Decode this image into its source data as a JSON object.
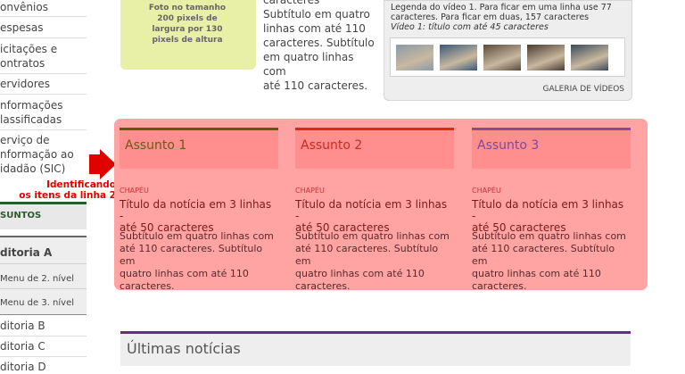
{
  "sidebar": {
    "items": [
      {
        "lines": [
          "onvênios"
        ]
      },
      {
        "lines": [
          "espesas"
        ]
      },
      {
        "lines": [
          "icitações e",
          "ontratos"
        ]
      },
      {
        "lines": [
          "ervidores"
        ]
      },
      {
        "lines": [
          "nformações",
          "lassificadas"
        ]
      },
      {
        "lines": [
          "erviço de",
          "nformação ao",
          "idadão (SIC)"
        ]
      }
    ],
    "assuntos": "SUNTOS",
    "editoria_a": "ditoria A",
    "menu_2": "Menu de 2. nível",
    "menu_3": "Menu de 3. nível",
    "editoria_b": "ditoria B",
    "editoria_c": "ditoria C",
    "editoria_d": "ditoria D"
  },
  "photo_placeholder": {
    "lines": [
      "Foto no tamanho",
      "200 pixels de",
      "largura por 130",
      "pixels de altura"
    ]
  },
  "top_subtitle": {
    "lines": [
      "caracteres",
      "Subtítulo em quatro",
      "linhas com até 110",
      "caracteres. Subtítulo",
      "em quatro linhas com",
      "até 110 caracteres."
    ]
  },
  "video": {
    "legend_lines": [
      "Legenda do vídeo 1. Para ficar em uma linha use 77",
      "caracteres. Para ficar em duas, 157 caracteres"
    ],
    "caption": "Vídeo 1: título com até 45 caracteres",
    "thumb_colors": [
      "#8a9aa8",
      "#3a5878",
      "#5a4a3a",
      "#4a3a30",
      "#3a4a5a"
    ],
    "gallery_label": "GALERIA DE VÍDEOS"
  },
  "annotation": {
    "lines": [
      "Identificando",
      "os itens da linha 2"
    ]
  },
  "colors": {
    "accent_red": "#e00000",
    "panel_pink": "#ffa3a3"
  },
  "columns": [
    {
      "title": "Assunto 1",
      "title_color": "#6a5a14",
      "bar_color": "#5a5a10",
      "chapeu": "CHAPÉU",
      "headline_lines": [
        "Título da notícia em 3 linhas -",
        "até 50 caracteres"
      ],
      "subtitle_lines": [
        "Subtítulo em quatro linhas com",
        "até 110 caracteres. Subtítulo em",
        "quatro linhas com até 110",
        "caracteres."
      ]
    },
    {
      "title": "Assunto 2",
      "title_color": "#cc2a1a",
      "bar_color": "#e02a10",
      "chapeu": "CHAPÉU",
      "headline_lines": [
        "Título da notícia em 3 linhas -",
        "até 50 caracteres"
      ],
      "subtitle_lines": [
        "Subtítulo em quatro linhas com",
        "até 110 caracteres. Subtítulo em",
        "quatro linhas com até 110",
        "caracteres."
      ]
    },
    {
      "title": "Assunto 3",
      "title_color": "#7a4a9a",
      "bar_color": "#8a4a9a",
      "chapeu": "CHAPÉU",
      "headline_lines": [
        "Título da notícia em 3 linhas -",
        "até 50 caracteres"
      ],
      "subtitle_lines": [
        "Subtítulo em quatro linhas com",
        "até 110 caracteres. Subtítulo em",
        "quatro linhas com até 110",
        "caracteres."
      ]
    }
  ],
  "ultimas": {
    "title": "Últimas notícias"
  }
}
